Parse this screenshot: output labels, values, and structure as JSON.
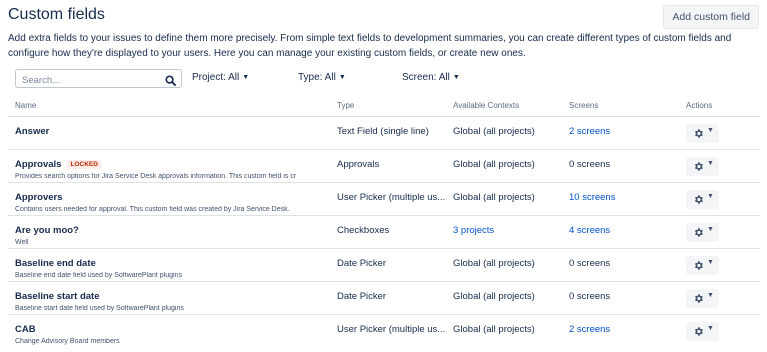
{
  "page": {
    "title": "Custom fields",
    "add_button": "Add custom field",
    "description": "Add extra fields to your issues to define them more precisely. From simple text fields to development summaries, you can create different types of custom fields and configure how they're displayed to your users. Here you can manage your existing custom fields, or create new ones."
  },
  "filters": {
    "search_placeholder": "Search...",
    "project": "Project: All",
    "type": "Type: All",
    "screen": "Screen: All"
  },
  "columns": {
    "name": "Name",
    "type": "Type",
    "contexts": "Available Contexts",
    "screens": "Screens",
    "actions": "Actions"
  },
  "rows": [
    {
      "name": "Answer",
      "locked": "",
      "description": "",
      "type": "Text Field (single line)",
      "contexts": "Global (all projects)",
      "contexts_link": false,
      "screens": "2 screens",
      "screens_link": true
    },
    {
      "name": "Approvals",
      "locked": "LOCKED",
      "description": "Provides search options for Jira Service Desk approvals information. This custom field is cr",
      "type": "Approvals",
      "contexts": "Global (all projects)",
      "contexts_link": false,
      "screens": "0 screens",
      "screens_link": false
    },
    {
      "name": "Approvers",
      "locked": "",
      "description": "Contains users needed for approval. This custom field was created by Jira Service Desk.",
      "type": "User Picker (multiple us...",
      "contexts": "Global (all projects)",
      "contexts_link": false,
      "screens": "10 screens",
      "screens_link": true
    },
    {
      "name": "Are you moo?",
      "locked": "",
      "description": "Well",
      "type": "Checkboxes",
      "contexts": "3 projects",
      "contexts_link": true,
      "screens": "4 screens",
      "screens_link": true
    },
    {
      "name": "Baseline end date",
      "locked": "",
      "description": "Baseline end date field used by SoftwarePlant plugins",
      "type": "Date Picker",
      "contexts": "Global (all projects)",
      "contexts_link": false,
      "screens": "0 screens",
      "screens_link": false
    },
    {
      "name": "Baseline start date",
      "locked": "",
      "description": "Baseline start date field used by SoftwarePlant plugins",
      "type": "Date Picker",
      "contexts": "Global (all projects)",
      "contexts_link": false,
      "screens": "0 screens",
      "screens_link": false
    },
    {
      "name": "CAB",
      "locked": "",
      "description": "Change Advisory Board members",
      "type": "User Picker (multiple us...",
      "contexts": "Global (all projects)",
      "contexts_link": false,
      "screens": "2 screens",
      "screens_link": true
    }
  ],
  "icons": {
    "search": "search-icon",
    "gear": "gear-icon",
    "chevron": "chevron-down-icon"
  },
  "colors": {
    "link": "#0052cc",
    "locked_text": "#bf2600",
    "locked_bg": "#ffebe6"
  }
}
